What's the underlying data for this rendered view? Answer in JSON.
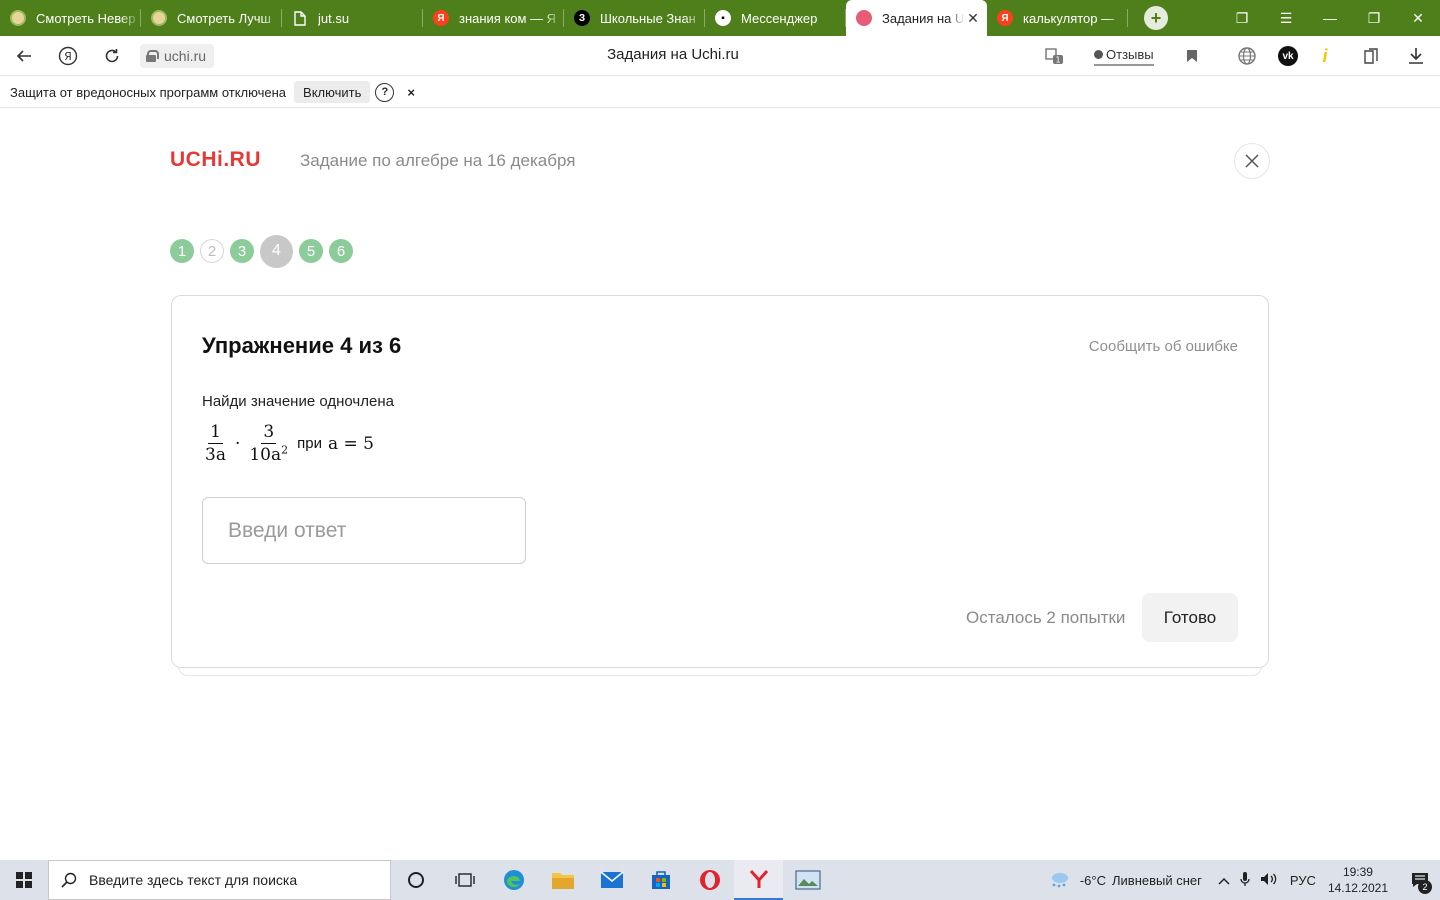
{
  "browser": {
    "tabs": [
      {
        "title": "Смотреть Невер",
        "icon": "anime-site-icon"
      },
      {
        "title": "Смотреть Лучш",
        "icon": "anime-site-icon"
      },
      {
        "title": "jut.su",
        "icon": "document-icon"
      },
      {
        "title": "знания ком — Я",
        "icon": "yandex-icon"
      },
      {
        "title": "Школьные Знан",
        "icon": "znanija-icon"
      },
      {
        "title": "Мессенджер",
        "icon": "messenger-icon"
      },
      {
        "title": "Задания на U",
        "icon": "uchi-icon"
      },
      {
        "title": "калькулятор —",
        "icon": "yandex-icon"
      }
    ],
    "address": {
      "url": "uchi.ru",
      "page_title": "Задания на Uchi.ru",
      "reviews_label": "Отзывы",
      "tab_count_badge": "1"
    },
    "security_bar": {
      "message": "Защита от вредоносных программ отключена",
      "enable_label": "Включить",
      "help_label": "?",
      "close_label": "×"
    }
  },
  "page": {
    "logo": "UCHi.RU",
    "assignment_title": "Задание по алгебре на 16 декабря",
    "steps": [
      {
        "label": "1",
        "state": "done"
      },
      {
        "label": "2",
        "state": "empty"
      },
      {
        "label": "3",
        "state": "done"
      },
      {
        "label": "4",
        "state": "current"
      },
      {
        "label": "5",
        "state": "done"
      },
      {
        "label": "6",
        "state": "done"
      }
    ],
    "exercise": {
      "heading": "Упражнение 4 из 6",
      "report_link": "Сообщить об ошибке",
      "task_text": "Найди значение одночлена",
      "formula": {
        "frac1_num": "1",
        "frac1_den": "3a",
        "dot": "·",
        "frac2_num": "3",
        "frac2_den": "10a",
        "frac2_den_exp": "2",
        "when": "при",
        "condition": "a = 5"
      },
      "answer_placeholder": "Введи ответ",
      "attempts_text": "Осталось 2 попытки",
      "submit_label": "Готово"
    }
  },
  "taskbar": {
    "search_placeholder": "Введите здесь текст для поиска",
    "weather_temp": "-6°C",
    "weather_text": "Ливневый снег",
    "language": "РУС",
    "time": "19:39",
    "date": "14.12.2021",
    "notifications_count": "2"
  },
  "colors": {
    "tabstrip_bg": "#4f7f1a",
    "logo_red": "#e53935",
    "step_done": "#8ccb9a",
    "step_current": "#c8c8c8"
  }
}
